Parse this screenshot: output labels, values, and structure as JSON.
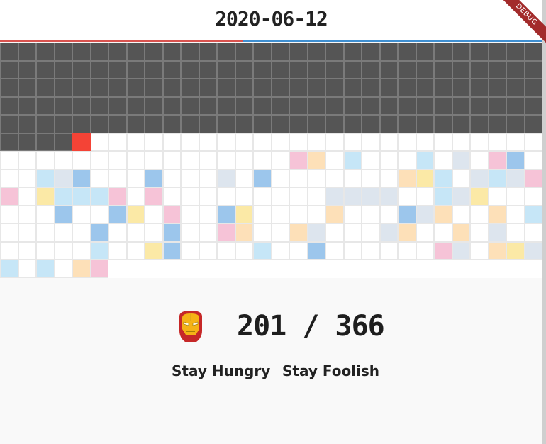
{
  "header": {
    "date": "2020-06-12",
    "year_progress": 0.448
  },
  "debug_banner": {
    "label": "DEBUG"
  },
  "grid": {
    "columns": 30,
    "total_days": 366,
    "days_passed": 154,
    "today_index": 154,
    "colors": {
      "past": "#555555",
      "today": "#f44336",
      "empty": "#ffffff",
      "blue": "#9cc6ec",
      "lightblue": "#c6e6f7",
      "pink": "#f6c3d7",
      "yellow": "#fbe9a6",
      "peach": "#fde0b8",
      "grey": "#dde5ee"
    },
    "future_cells": [
      "empty",
      "empty",
      "empty",
      "empty",
      "empty",
      "empty",
      "empty",
      "empty",
      "empty",
      "empty",
      "empty",
      "empty",
      "empty",
      "empty",
      "empty",
      "empty",
      "empty",
      "empty",
      "empty",
      "empty",
      "empty",
      "empty",
      "empty",
      "empty",
      "empty",
      "empty",
      "empty",
      "empty",
      "empty",
      "empty",
      "empty",
      "empty",
      "empty",
      "empty",
      "empty",
      "empty",
      "empty",
      "empty",
      "empty",
      "empty",
      "empty",
      "pink",
      "peach",
      "empty",
      "lightblue",
      "empty",
      "empty",
      "empty",
      "lightblue",
      "empty",
      "grey",
      "empty",
      "pink",
      "blue",
      "empty",
      "empty",
      "empty",
      "lightblue",
      "grey",
      "blue",
      "empty",
      "empty",
      "empty",
      "blue",
      "empty",
      "empty",
      "empty",
      "grey",
      "empty",
      "blue",
      "empty",
      "empty",
      "empty",
      "empty",
      "empty",
      "empty",
      "empty",
      "peach",
      "yellow",
      "lightblue",
      "empty",
      "grey",
      "lightblue",
      "grey",
      "pink",
      "pink",
      "empty",
      "yellow",
      "lightblue",
      "lightblue",
      "lightblue",
      "pink",
      "empty",
      "pink",
      "empty",
      "empty",
      "empty",
      "empty",
      "empty",
      "empty",
      "empty",
      "empty",
      "empty",
      "grey",
      "grey",
      "grey",
      "grey",
      "empty",
      "empty",
      "lightblue",
      "grey",
      "yellow",
      "empty",
      "empty",
      "empty",
      "empty",
      "empty",
      "empty",
      "blue",
      "empty",
      "empty",
      "blue",
      "yellow",
      "empty",
      "pink",
      "empty",
      "empty",
      "blue",
      "yellow",
      "empty",
      "empty",
      "empty",
      "empty",
      "peach",
      "empty",
      "empty",
      "empty",
      "blue",
      "grey",
      "peach",
      "empty",
      "empty",
      "peach",
      "empty",
      "lightblue",
      "empty",
      "empty",
      "empty",
      "empty",
      "empty",
      "blue",
      "empty",
      "empty",
      "empty",
      "blue",
      "empty",
      "empty",
      "pink",
      "peach",
      "empty",
      "empty",
      "peach",
      "grey",
      "empty",
      "empty",
      "empty",
      "grey",
      "peach",
      "empty",
      "empty",
      "peach",
      "empty",
      "grey",
      "empty",
      "empty",
      "empty",
      "empty",
      "empty",
      "empty",
      "empty",
      "lightblue",
      "empty",
      "empty",
      "yellow",
      "blue",
      "empty",
      "empty",
      "empty",
      "empty",
      "lightblue",
      "empty",
      "empty",
      "blue",
      "empty",
      "empty",
      "empty",
      "empty",
      "empty",
      "empty",
      "pink",
      "grey",
      "empty",
      "peach",
      "yellow",
      "grey",
      "lightblue",
      "empty",
      "lightblue",
      "empty",
      "peach",
      "pink",
      "empty",
      "grey",
      "empty",
      "empty",
      "blue",
      "pink",
      "empty",
      "pink",
      "empty",
      "empty",
      "empty",
      "empty",
      "empty",
      "empty",
      "grey",
      "blue",
      "peach",
      "blue",
      "pink",
      "empty",
      "lightblue"
    ]
  },
  "stats": {
    "icon": "iron-man-helmet-icon",
    "elapsed": "201",
    "separator": " / ",
    "total": "366",
    "motto_left": "Stay Hungry",
    "motto_right": "Stay Foolish"
  }
}
